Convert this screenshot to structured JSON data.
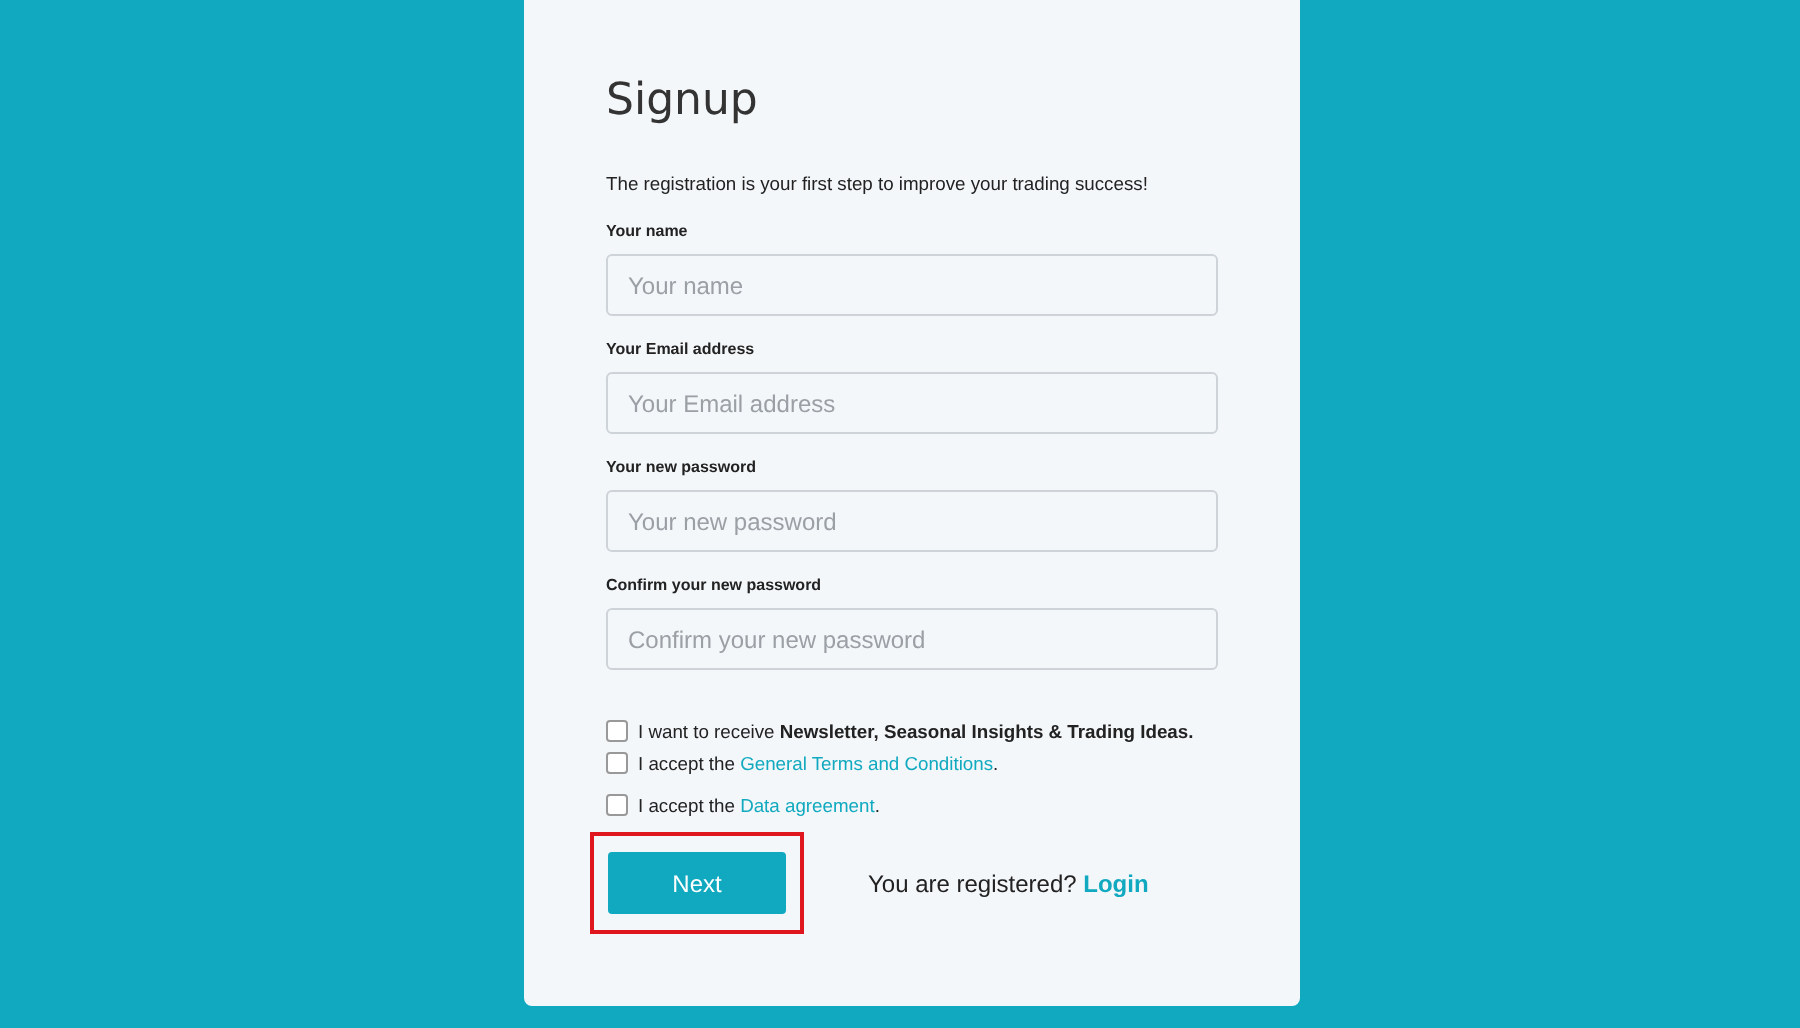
{
  "title": "Signup",
  "intro": "The registration is your first step to improve your trading success!",
  "fields": [
    {
      "label": "Your name",
      "placeholder": "Your name"
    },
    {
      "label": "Your Email address",
      "placeholder": "Your Email address"
    },
    {
      "label": "Your new password",
      "placeholder": "Your new password"
    },
    {
      "label": "Confirm your new password",
      "placeholder": "Confirm your new password"
    }
  ],
  "checkboxes": [
    {
      "checked": false,
      "text": "I want to receive **Newsletter, Seasonal Insights & Trading Ideas.**"
    },
    {
      "checked": false,
      "text": "I accept the",
      "link": "General Terms and Conditions",
      "suffix": "."
    },
    {
      "checked": false,
      "text": "I accept the",
      "link": "Data agreement",
      "suffix": "."
    }
  ],
  "next_button": {
    "label": "Next",
    "highlighted": true
  },
  "login_prompt": {
    "text": "You are registered?",
    "link": "Login"
  }
}
